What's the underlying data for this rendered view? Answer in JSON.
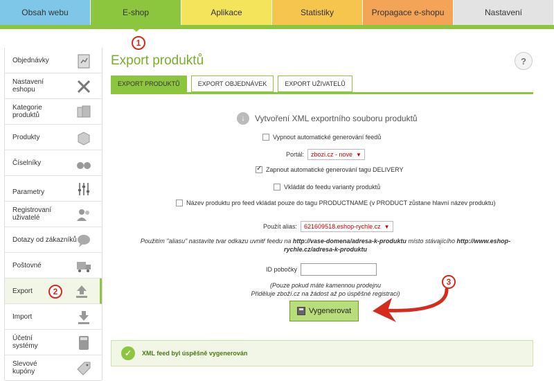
{
  "topnav": {
    "tabs": [
      {
        "label": "Obsah webu",
        "color": "#f3ee8e"
      },
      {
        "label": "E-shop",
        "color": "#8cc63f"
      },
      {
        "label": "Aplikace",
        "color": "#f4e45c"
      },
      {
        "label": "Statistiky",
        "color": "#f6c54e"
      },
      {
        "label": "Propagace e-shopu",
        "color": "#f4a456"
      },
      {
        "label": "Nastavení",
        "color": "#e3e3e3"
      }
    ],
    "first_tab_color": "#7fc7e8"
  },
  "callouts": {
    "one": "1",
    "two": "2",
    "three": "3"
  },
  "sidebar": {
    "items": [
      {
        "label": "Objednávky",
        "icon": "clipboard-icon"
      },
      {
        "label": "Nastavení eshopu",
        "icon": "tools-icon"
      },
      {
        "label": "Kategorie produktů",
        "icon": "boxes-icon"
      },
      {
        "label": "Produkty",
        "icon": "box-icon"
      },
      {
        "label": "Číselníky",
        "icon": "binoculars-icon"
      },
      {
        "label": "Parametry",
        "icon": "sliders-icon"
      },
      {
        "label": "Registrovaní uživatelé",
        "icon": "users-icon"
      },
      {
        "label": "Dotazy od zákazníků",
        "icon": "chat-icon"
      },
      {
        "label": "Poštovné",
        "icon": "truck-icon"
      },
      {
        "label": "Export",
        "icon": "upload-icon"
      },
      {
        "label": "Import",
        "icon": "download-icon"
      },
      {
        "label": "Účetní systémy",
        "icon": "calculator-icon"
      },
      {
        "label": "Slevové kupóny",
        "icon": "tag-icon"
      }
    ]
  },
  "main": {
    "title": "Export produktů",
    "help": "?",
    "tabs": [
      "EXPORT PRODUKTŮ",
      "EXPORT OBJEDNÁVEK",
      "EXPORT UŽIVATELŮ"
    ],
    "section_title": "Vytvoření XML exportního souboru produktů",
    "opt_disable_auto": "Vypnout automatické generování feedů",
    "portal_label": "Portál:",
    "portal_value": "zbozi.cz - nove",
    "opt_delivery": "Zapnout automatické generování tagu DELIVERY",
    "opt_variants": "Vkládát do feedu varianty produktů",
    "opt_productname": "Název produktu pro feed vkládat pouze do tagu PRODUCTNAME (v PRODUCT zůstane hlavní název produktu)",
    "alias_label": "Použít alias:",
    "alias_value": "621609518.eshop-rychle.cz",
    "alias_note_1": "Použitím \"aliasu\" nastavíte tvar odkazu uvnitř feedu na",
    "alias_note_url1": "http://vase-domena/adresa-k-produktu",
    "alias_note_2": "místo stávajícího",
    "alias_note_url2": "http://www.eshop-rychle.cz/adresa-k-produktu",
    "branch_label": "ID pobočky",
    "branch_note_1": "(Pouze pokud máte kamennou prodejnu",
    "branch_note_2": "Přiděluje zboží.cz na žádost až po úspěšné registraci)",
    "generate_button": "Vygenerovat",
    "success_message": "XML feed byl úspěšně vygenerován"
  },
  "colors": {
    "accent": "#8cc63f",
    "annotation": "#d52b1e"
  }
}
